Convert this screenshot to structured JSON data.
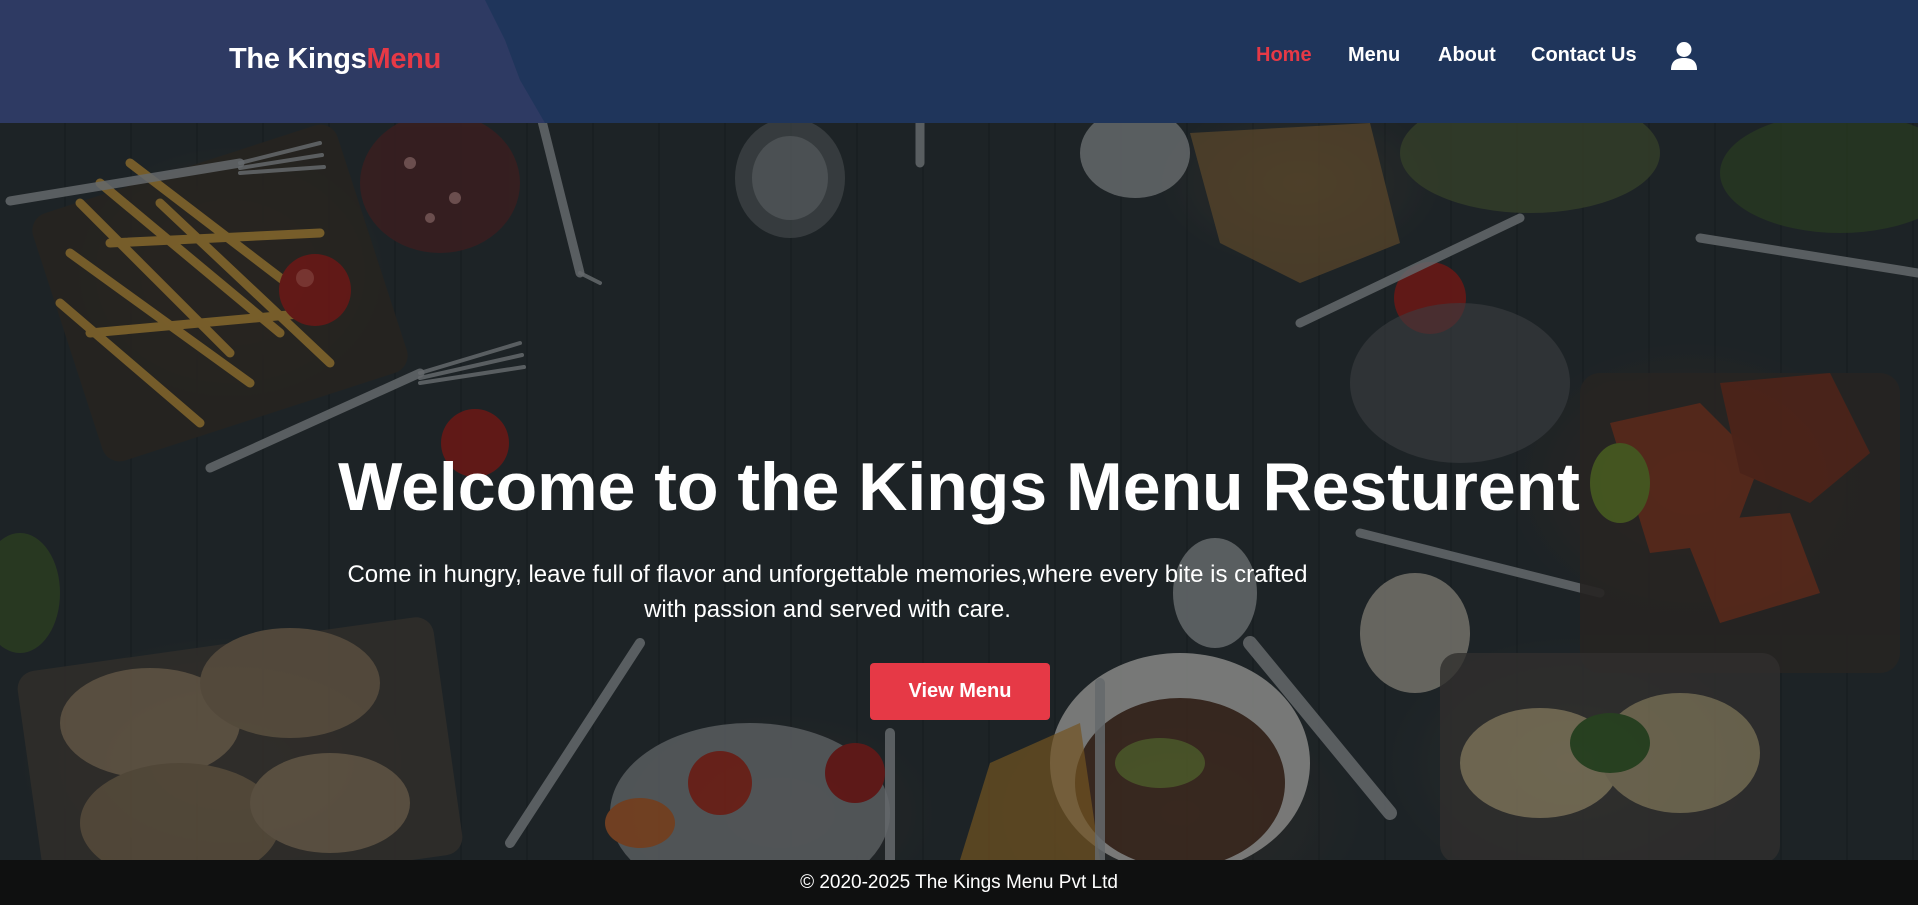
{
  "header": {
    "brand_main": "The Kings",
    "brand_accent": "Menu",
    "nav": [
      {
        "label": "Home",
        "active": true
      },
      {
        "label": "Menu",
        "active": false
      },
      {
        "label": "About",
        "active": false
      },
      {
        "label": "Contact Us",
        "active": false
      }
    ],
    "user_icon": "user-icon"
  },
  "hero": {
    "title": "Welcome to the Kings Menu Resturent",
    "subtitle": "Come in hungry, leave full of flavor and unforgettable memories,where every bite is crafted with passion and served with care.",
    "button_label": "View Menu"
  },
  "footer": {
    "copyright": "© 2020-2025 The Kings Menu Pvt Ltd"
  },
  "colors": {
    "header_bg": "#1f355b",
    "brand_panel_bg": "#2e3a63",
    "accent": "#e63946",
    "footer_bg": "#0f1010"
  }
}
